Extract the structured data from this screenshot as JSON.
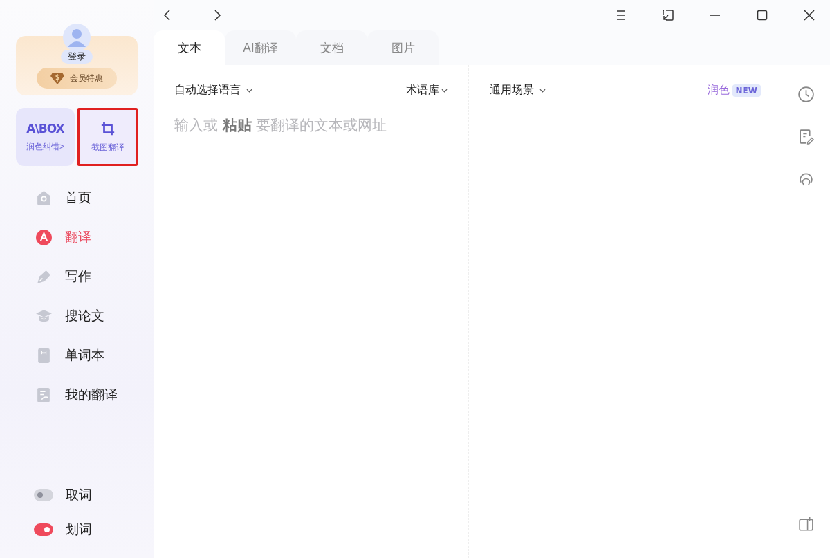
{
  "account": {
    "login_label": "登录",
    "vip_label": "会员特惠"
  },
  "feature_cards": [
    {
      "kind": "aibox",
      "title": "A\\BOX",
      "subtitle": "润色纠错>",
      "highlighted": false
    },
    {
      "kind": "crop",
      "subtitle": "截图翻译",
      "highlighted": true
    }
  ],
  "nav": [
    {
      "kind": "home",
      "label": "首页",
      "selected": false
    },
    {
      "kind": "translate",
      "label": "翻译",
      "selected": true
    },
    {
      "kind": "write",
      "label": "写作",
      "selected": false
    },
    {
      "kind": "paper",
      "label": "搜论文",
      "selected": false
    },
    {
      "kind": "wordbook",
      "label": "单词本",
      "selected": false
    },
    {
      "kind": "mytrans",
      "label": "我的翻译",
      "selected": false
    }
  ],
  "toggles": [
    {
      "label": "取词",
      "on": false
    },
    {
      "label": "划词",
      "on": true
    }
  ],
  "tabs": [
    {
      "label": "文本",
      "selected": true
    },
    {
      "label": "AI翻译",
      "selected": false
    },
    {
      "label": "文档",
      "selected": false
    },
    {
      "label": "图片",
      "selected": false
    }
  ],
  "source": {
    "language": "自动选择语言",
    "glossary": "术语库",
    "placeholder": "输入或 **粘贴** 要翻译的文本或网址"
  },
  "target": {
    "scene": "通用场景",
    "polish": "润色",
    "polish_badge": "NEW"
  }
}
